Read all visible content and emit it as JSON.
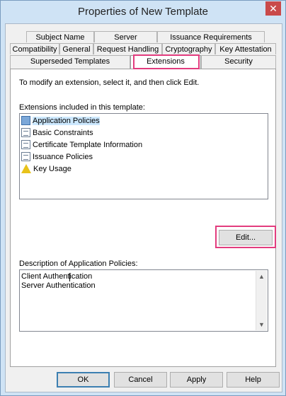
{
  "window": {
    "title": "Properties of New Template",
    "close_glyph": "✕"
  },
  "tabs": {
    "row1": [
      "Subject Name",
      "Server",
      "Issuance Requirements"
    ],
    "row2": [
      "Compatibility",
      "General",
      "Request Handling",
      "Cryptography",
      "Key Attestation"
    ],
    "row3": [
      "Superseded Templates",
      "Extensions",
      "Security"
    ]
  },
  "panel": {
    "instruction": "To modify an extension, select it, and then click Edit.",
    "extensions_label": "Extensions included in this template:",
    "extensions": [
      {
        "label": "Application Policies",
        "icon": "application-policy-icon",
        "selected": true
      },
      {
        "label": "Basic Constraints",
        "icon": "certificate-doc-icon",
        "selected": false
      },
      {
        "label": "Certificate Template Information",
        "icon": "certificate-doc-icon",
        "selected": false
      },
      {
        "label": "Issuance Policies",
        "icon": "certificate-doc-icon",
        "selected": false
      },
      {
        "label": "Key Usage",
        "icon": "warning-key-icon",
        "selected": false
      }
    ],
    "edit_button": "Edit...",
    "description_label": "Description of Application Policies:",
    "description_lines": [
      "Client Authentication",
      "Server Authentication"
    ]
  },
  "buttons": {
    "ok": "OK",
    "cancel": "Cancel",
    "apply": "Apply",
    "help": "Help"
  },
  "colors": {
    "highlight": "#e23c7e",
    "selection": "#cce8ff",
    "titlebar": "#cfe3f5"
  }
}
